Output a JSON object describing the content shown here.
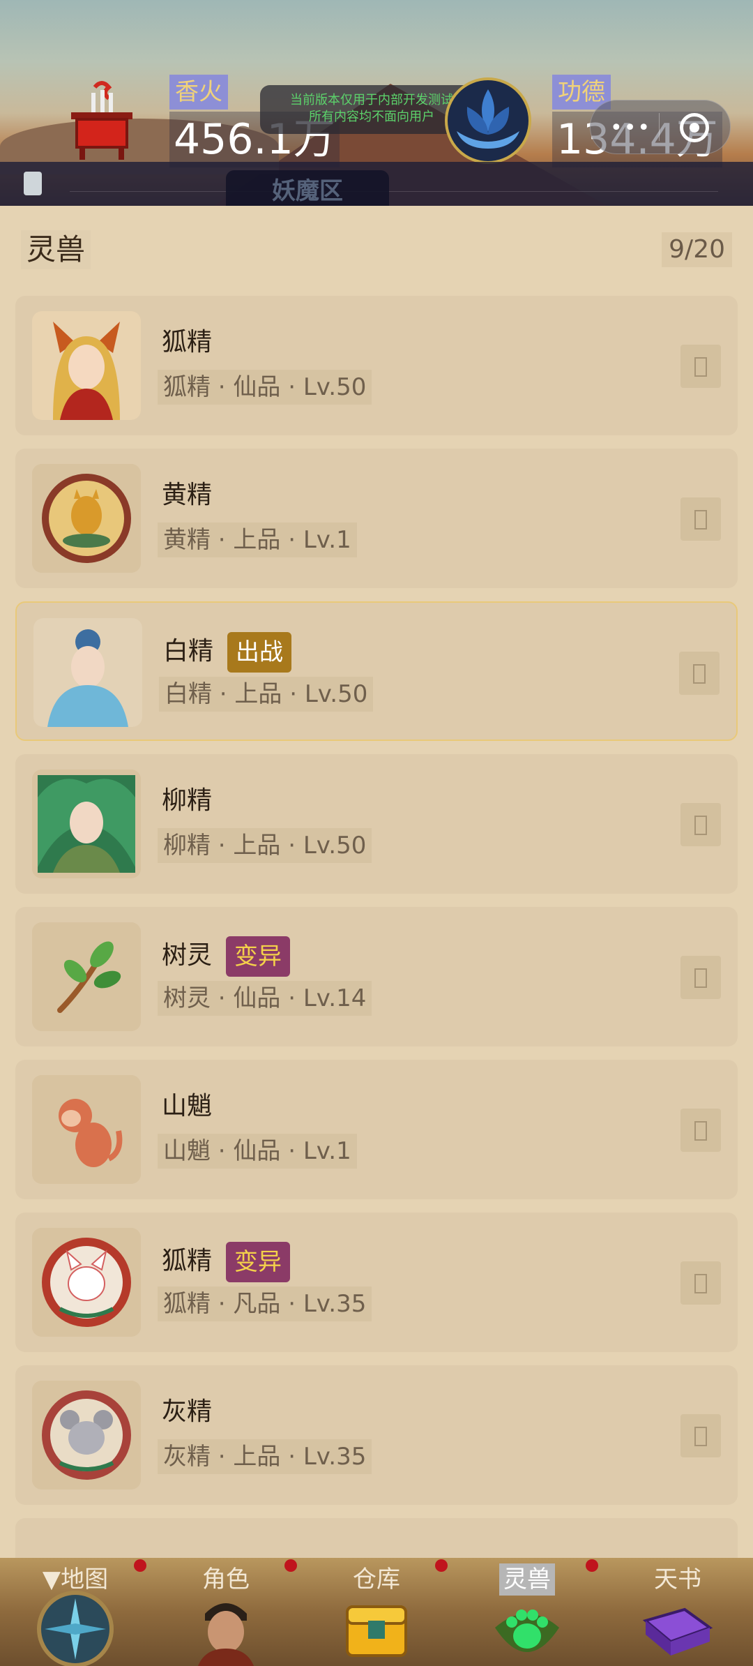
{
  "header": {
    "incense_label": "香火",
    "incense_value": "456.1万",
    "merit_label": "功德",
    "merit_value": "134.4万",
    "notice_line1": "当前版本仅用于内部开发测试",
    "notice_line2": "所有内容均不面向用户",
    "area_tab": "妖魔区",
    "menu_dots": "•••"
  },
  "section": {
    "title": "灵兽",
    "count": "9/20"
  },
  "beasts": [
    {
      "name": "狐精",
      "tag": "",
      "meta": "狐精 · 仙品 · Lv.50"
    },
    {
      "name": "黄精",
      "tag": "",
      "meta": "黄精 · 上品 · Lv.1"
    },
    {
      "name": "白精",
      "tag": "出战",
      "meta": "白精 · 上品 · Lv.50"
    },
    {
      "name": "柳精",
      "tag": "",
      "meta": "柳精 · 上品 · Lv.50"
    },
    {
      "name": "树灵",
      "tag": "变异",
      "meta": "树灵 · 仙品 · Lv.14"
    },
    {
      "name": "山魈",
      "tag": "",
      "meta": "山魈 · 仙品 · Lv.1"
    },
    {
      "name": "狐精",
      "tag": "变异",
      "meta": "狐精 · 凡品 · Lv.35"
    },
    {
      "name": "灰精",
      "tag": "",
      "meta": "灰精 · 上品 · Lv.35"
    }
  ],
  "nav": [
    {
      "label": "▼地图",
      "icon": "compass-icon"
    },
    {
      "label": "角色",
      "icon": "warrior-portrait-icon"
    },
    {
      "label": "仓库",
      "icon": "treasure-chest-icon"
    },
    {
      "label": "灵兽",
      "icon": "paw-icon",
      "active": true
    },
    {
      "label": "天书",
      "icon": "book-icon"
    }
  ],
  "colors": {
    "battle_tag": "#a8791c",
    "mutant_tag": "#8b3b67",
    "card_bg": "#decbac",
    "page_bg": "#e5d3b3"
  }
}
